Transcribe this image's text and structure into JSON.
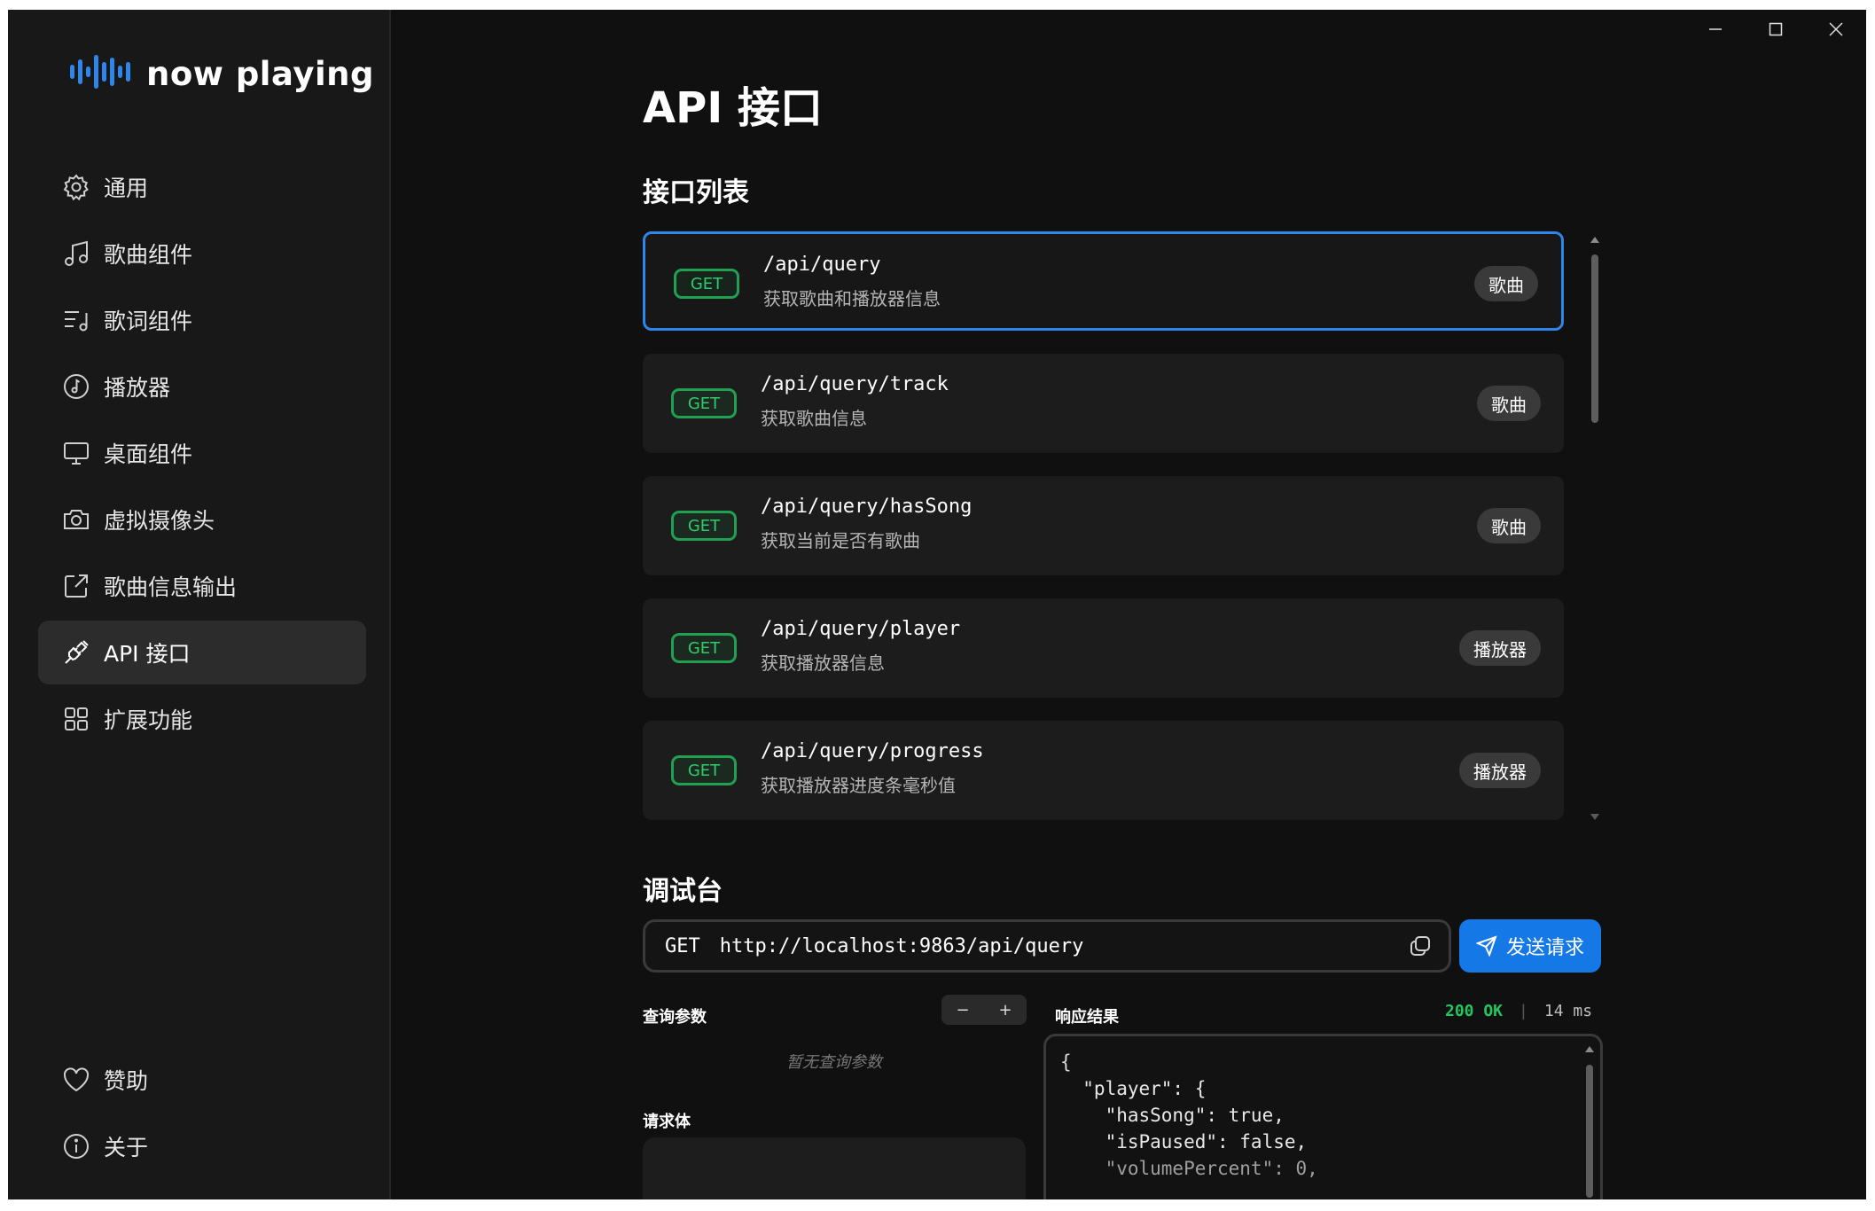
{
  "app": {
    "name": "now playing"
  },
  "window_controls": {
    "minimize": "minimize-icon",
    "maximize": "maximize-icon",
    "close": "close-icon"
  },
  "sidebar": {
    "items": [
      {
        "label": "通用",
        "icon": "gear-icon"
      },
      {
        "label": "歌曲组件",
        "icon": "music-note-icon"
      },
      {
        "label": "歌词组件",
        "icon": "lyrics-icon"
      },
      {
        "label": "播放器",
        "icon": "player-icon"
      },
      {
        "label": "桌面组件",
        "icon": "monitor-icon"
      },
      {
        "label": "虚拟摄像头",
        "icon": "camera-icon"
      },
      {
        "label": "歌曲信息输出",
        "icon": "export-icon"
      },
      {
        "label": "API 接口",
        "icon": "plug-icon",
        "active": true
      },
      {
        "label": "扩展功能",
        "icon": "grid-icon"
      }
    ],
    "bottom_items": [
      {
        "label": "赞助",
        "icon": "heart-icon"
      },
      {
        "label": "关于",
        "icon": "info-icon"
      }
    ]
  },
  "main": {
    "title": "API 接口",
    "api_list": {
      "heading": "接口列表",
      "items": [
        {
          "method": "GET",
          "path": "/api/query",
          "description": "获取歌曲和播放器信息",
          "tag": "歌曲",
          "selected": true
        },
        {
          "method": "GET",
          "path": "/api/query/track",
          "description": "获取歌曲信息",
          "tag": "歌曲"
        },
        {
          "method": "GET",
          "path": "/api/query/hasSong",
          "description": "获取当前是否有歌曲",
          "tag": "歌曲"
        },
        {
          "method": "GET",
          "path": "/api/query/player",
          "description": "获取播放器信息",
          "tag": "播放器"
        },
        {
          "method": "GET",
          "path": "/api/query/progress",
          "description": "获取播放器进度条毫秒值",
          "tag": "播放器"
        }
      ]
    },
    "debugger": {
      "heading": "调试台",
      "method": "GET",
      "url": "http://localhost:9863/api/query",
      "send_label": "发送请求",
      "query_params_label": "查询参数",
      "stepper_minus": "−",
      "stepper_plus": "+",
      "empty_params": "暂无查询参数",
      "request_body_label": "请求体",
      "response_label": "响应结果",
      "status": "200 OK",
      "separator": "|",
      "elapsed": "14 ms",
      "response_lines": [
        "{",
        "  \"player\": {",
        "    \"hasSong\": true,",
        "    \"isPaused\": false,",
        "    \"volumePercent\": 0,"
      ]
    }
  },
  "colors": {
    "accent": "#1479e6",
    "get_badge": "#22a052",
    "selected_border": "#2f86ea"
  }
}
